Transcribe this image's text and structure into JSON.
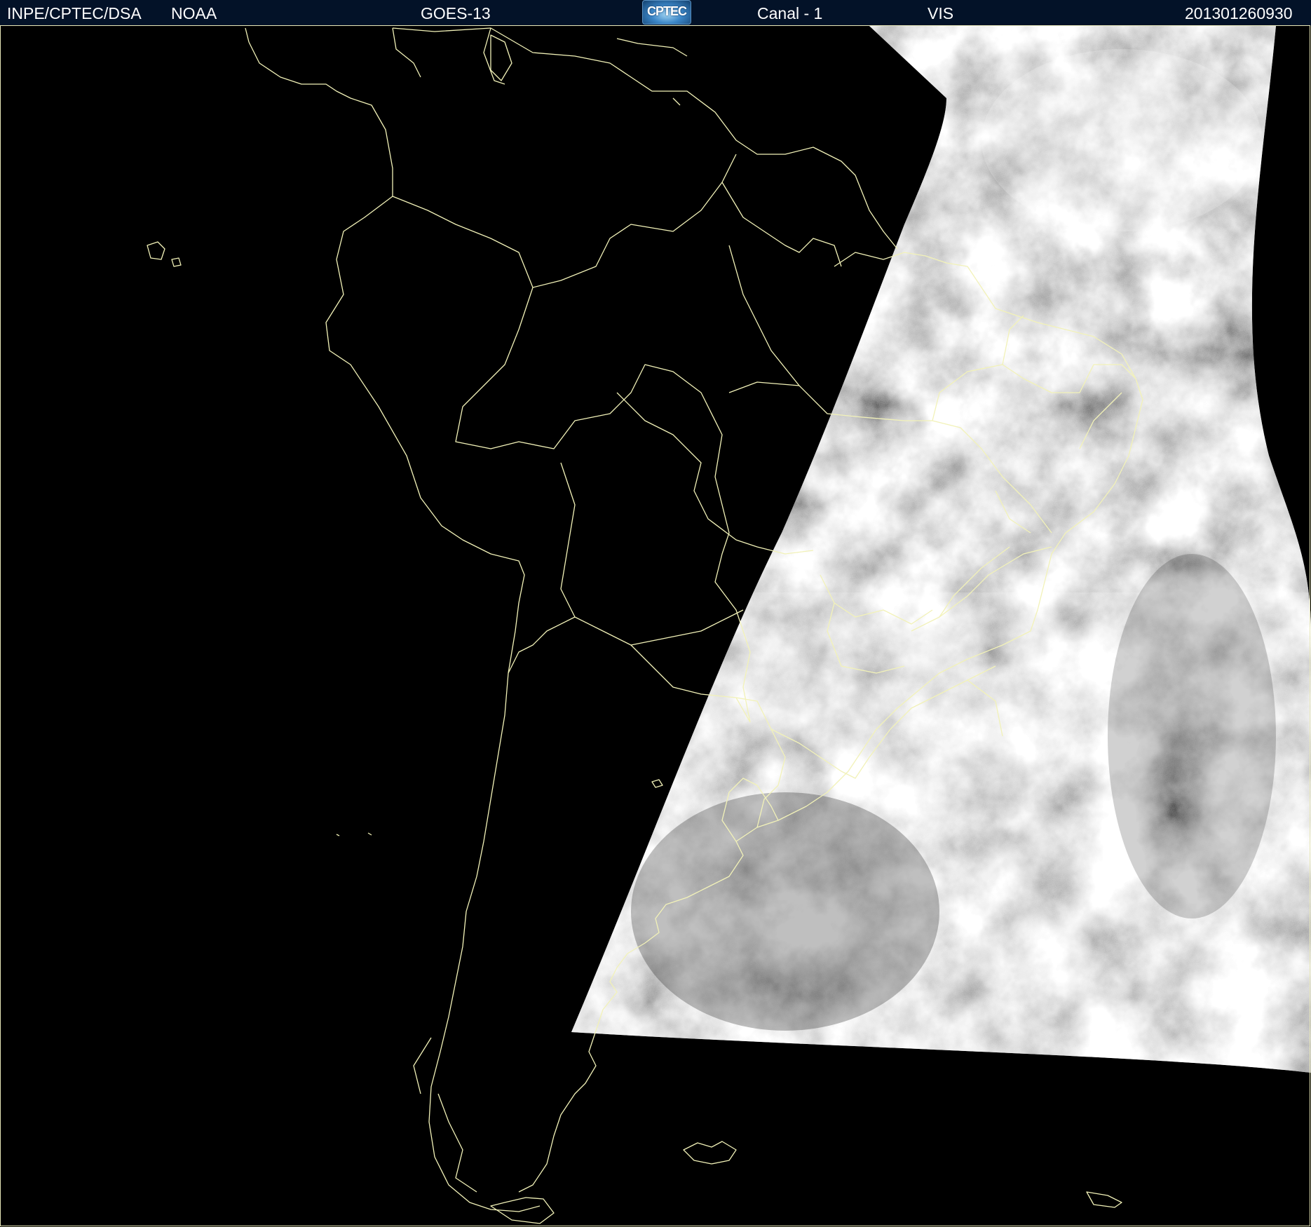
{
  "header": {
    "organization": "INPE/CPTEC/DSA",
    "agency": "NOAA",
    "satellite": "GOES-13",
    "logo_text": "CPTEC",
    "channel": "Canal - 1",
    "band": "VIS",
    "timestamp": "201301260930"
  },
  "colors": {
    "header_background": "#031228",
    "header_text": "#ffffff",
    "coastline": "#f2f2b8",
    "background": "#000000"
  }
}
